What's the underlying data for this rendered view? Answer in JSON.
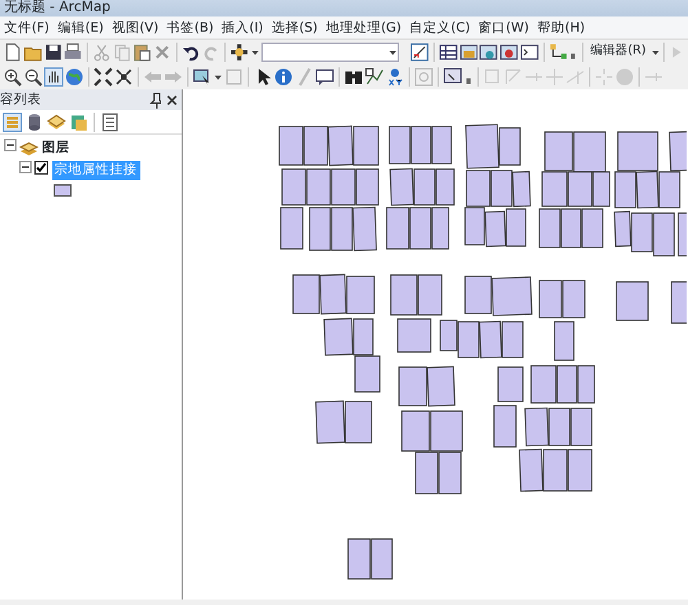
{
  "window": {
    "title": "无标题 - ArcMap"
  },
  "menu": [
    "文件(F)",
    "编辑(E)",
    "视图(V)",
    "书签(B)",
    "插入(I)",
    "选择(S)",
    "地理处理(G)",
    "自定义(C)",
    "窗口(W)",
    "帮助(H)"
  ],
  "editor_toolbar": {
    "label": "编辑器(R)"
  },
  "toc": {
    "title": "容列表",
    "layers": [
      {
        "label": "图层",
        "expanded": true,
        "children": [
          {
            "label": "宗地属性挂接",
            "checked": true,
            "selected": true,
            "expanded": true,
            "color": "#c9c3ef"
          }
        ]
      }
    ]
  }
}
